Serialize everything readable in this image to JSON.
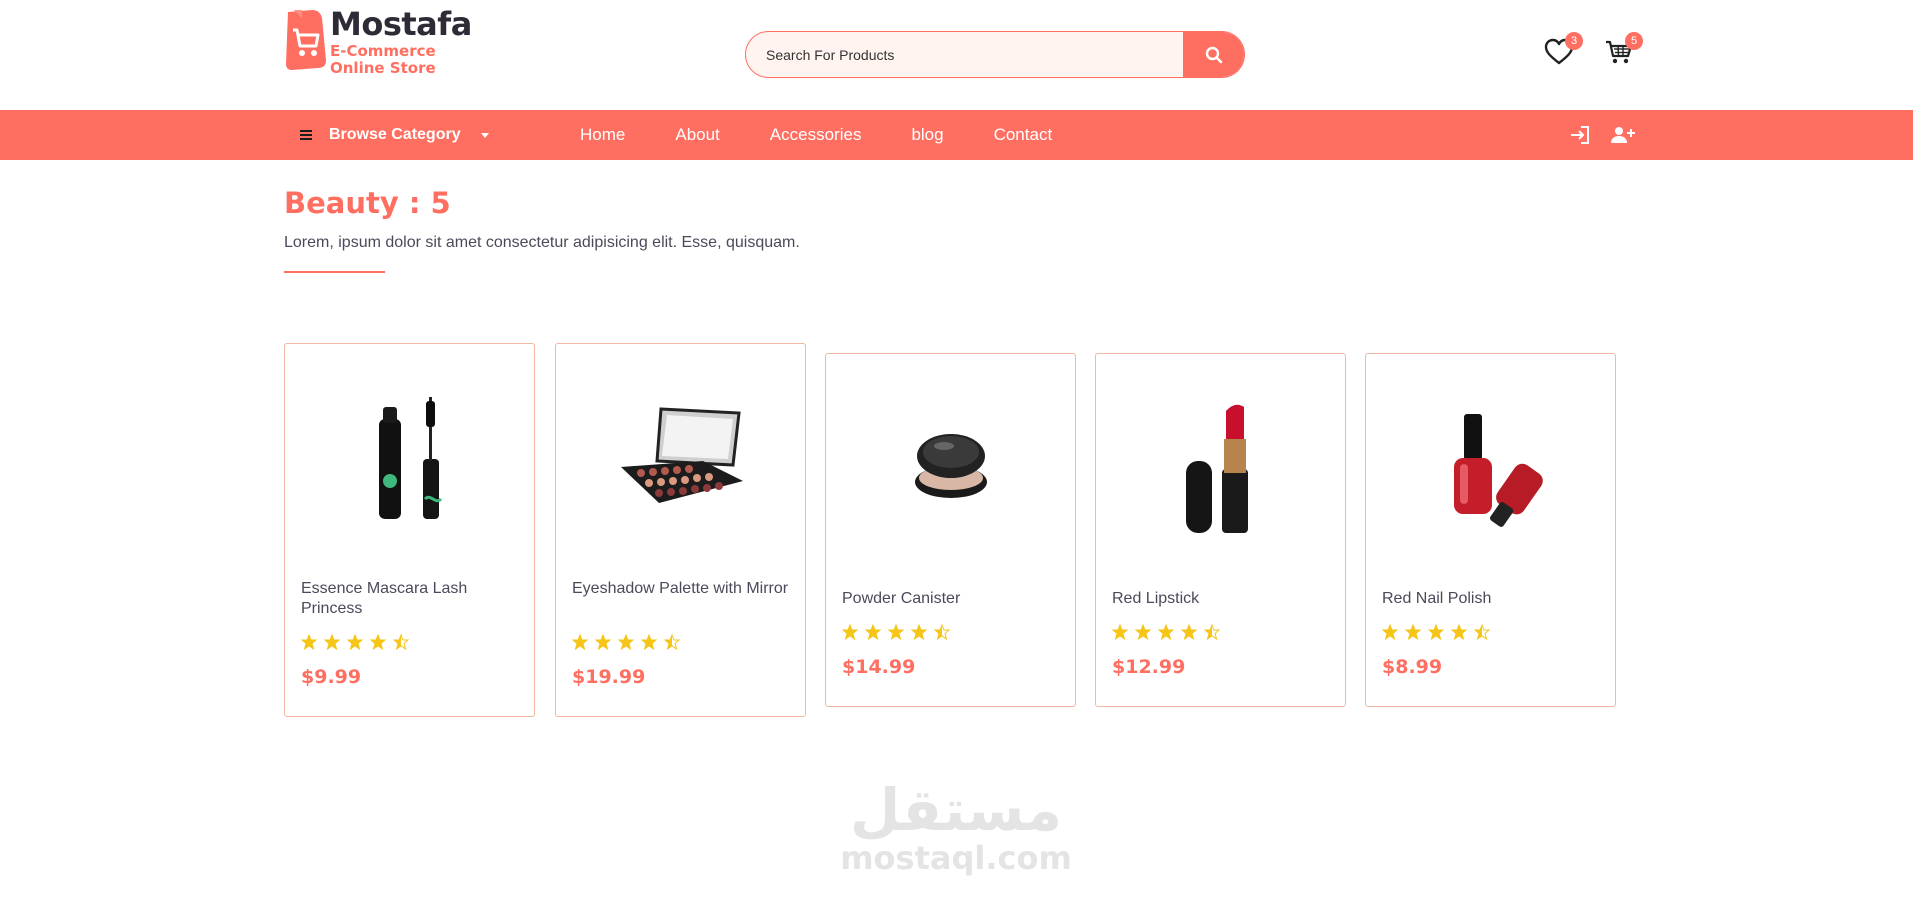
{
  "brand": {
    "name": "Mostafa",
    "subtitle_line1": "E-Commerce",
    "subtitle_line2": "Online Store",
    "accent_color": "#ff6f61"
  },
  "search": {
    "placeholder": "Search For Products",
    "icon": "search-icon"
  },
  "header_icons": {
    "wishlist": {
      "icon": "heart-icon",
      "count": "3"
    },
    "cart": {
      "icon": "cart-icon",
      "count": "5"
    }
  },
  "navbar": {
    "browse_label": "Browse Category",
    "links": [
      "Home",
      "About",
      "Accessories",
      "blog",
      "Contact"
    ],
    "right_icons": [
      "login-icon",
      "add-user-icon"
    ]
  },
  "category": {
    "title": "Beauty : 5",
    "description": "Lorem, ipsum dolor sit amet consectetur adipisicing elit. Esse, quisquam."
  },
  "products": [
    {
      "name": "Essence Mascara Lash Princess",
      "price": "$9.99",
      "rating": 4.5,
      "image": "mascara"
    },
    {
      "name": "Eyeshadow Palette with Mirror",
      "price": "$19.99",
      "rating": 4.5,
      "image": "eyeshadow-palette"
    },
    {
      "name": "Powder Canister",
      "price": "$14.99",
      "rating": 4.5,
      "image": "powder-canister"
    },
    {
      "name": "Red Lipstick",
      "price": "$12.99",
      "rating": 4.5,
      "image": "lipstick"
    },
    {
      "name": "Red Nail Polish",
      "price": "$8.99",
      "rating": 4.5,
      "image": "nail-polish"
    }
  ],
  "watermark": {
    "arabic": "مستقل",
    "latin": "mostaql.com"
  }
}
